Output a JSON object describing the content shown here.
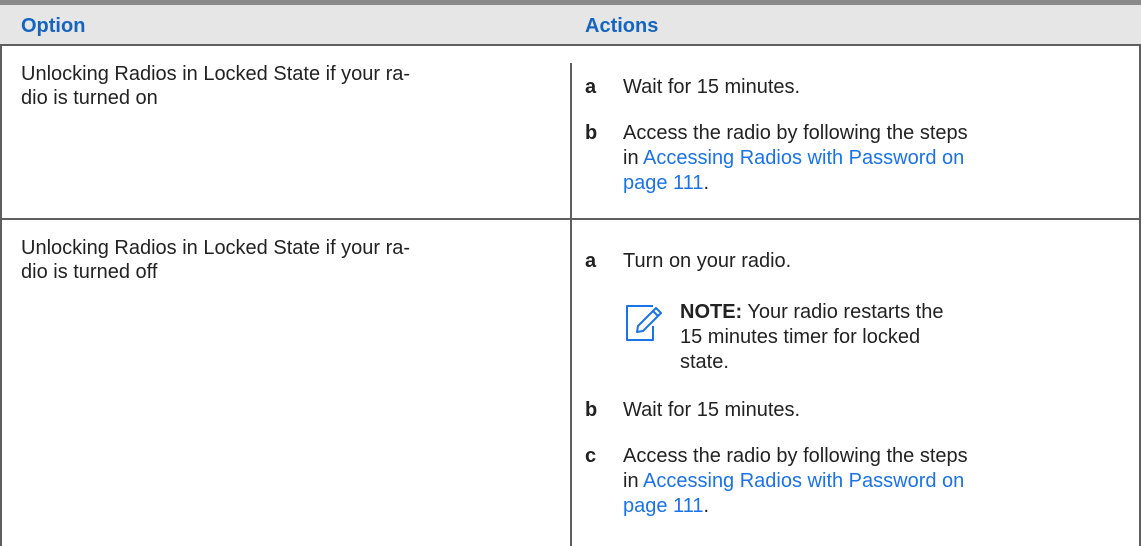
{
  "header": {
    "option": "Option",
    "actions": "Actions"
  },
  "rows": [
    {
      "option_line1": "Unlocking Radios in Locked State if your ra-",
      "option_line2": "dio is turned on",
      "steps": [
        {
          "letter": "a",
          "text": "Wait for 15 minutes."
        },
        {
          "letter": "b",
          "line1": "Access the radio by following the steps",
          "line2_prefix": "in ",
          "link_part1": "Accessing Radios with Password on",
          "link_part2": "page 111",
          "suffix": "."
        }
      ]
    },
    {
      "option_line1": "Unlocking Radios in Locked State if your ra-",
      "option_line2": "dio is turned off",
      "steps": [
        {
          "letter": "a",
          "text": "Turn on your radio."
        },
        {
          "letter": "b",
          "text": "Wait for 15 minutes."
        },
        {
          "letter": "c",
          "line1": "Access the radio by following the steps",
          "line2_prefix": "in ",
          "link_part1": "Accessing Radios with Password on",
          "link_part2": "page 111",
          "suffix": "."
        }
      ],
      "note": {
        "label": "NOTE:",
        "line1": "Your radio restarts the",
        "line2": "15 minutes timer for locked",
        "line3": "state."
      }
    }
  ],
  "colors": {
    "header_text": "#1565c0",
    "link": "#1a73e8",
    "header_bg": "#e6e6e6",
    "rule": "#5f5f5f"
  },
  "icons": {
    "note": "note-pencil-icon"
  }
}
